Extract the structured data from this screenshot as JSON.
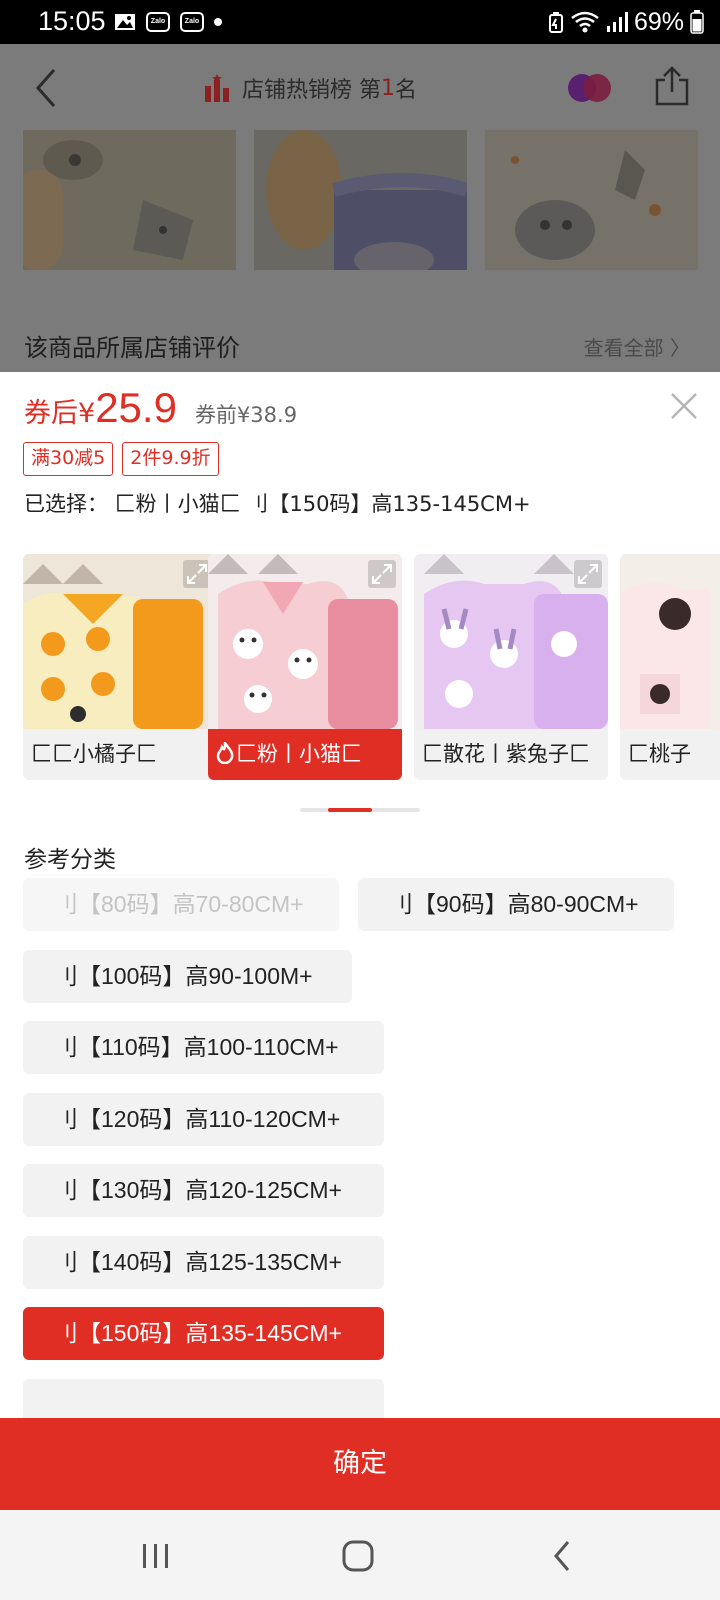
{
  "status_bar": {
    "time": "15:05",
    "notification_icons": [
      "image-icon",
      "zalo-icon",
      "zalo-icon",
      "dot-icon"
    ],
    "zalo_text": "Zalo",
    "battery": "69%"
  },
  "background_page": {
    "rank_prefix": "店铺热销榜 第",
    "rank_number": "1",
    "rank_suffix": "名",
    "review_title": "该商品所属店铺评价",
    "view_all": "查看全部"
  },
  "sheet": {
    "price_prefix": "券后¥",
    "price_value": "25.9",
    "original_price": "券前¥38.9",
    "promos": [
      "满30减5",
      "2件9.9折"
    ],
    "selected": "已选择： 匚粉丨小猫匚  刂【150码】高135-145CM+",
    "variants": [
      {
        "label": "匚匚小橘子匚",
        "selected": false
      },
      {
        "label": "匚粉丨小猫匚",
        "selected": true
      },
      {
        "label": "匚散花丨紫兔子匚",
        "selected": false
      },
      {
        "label": "匚桃子",
        "selected": false
      }
    ],
    "scroll_position": 0.37,
    "section_title": "参考分类",
    "sizes": [
      {
        "label": "刂【80码】高70-80CM+",
        "state": "disabled"
      },
      {
        "label": "刂【90码】高80-90CM+",
        "state": "normal"
      },
      {
        "label": "刂【100码】高90-100M+",
        "state": "normal"
      },
      {
        "label": "刂【110码】高100-110CM+",
        "state": "normal"
      },
      {
        "label": "刂【120码】高110-120CM+",
        "state": "normal"
      },
      {
        "label": "刂【130码】高120-125CM+",
        "state": "normal"
      },
      {
        "label": "刂【140码】高125-135CM+",
        "state": "normal"
      },
      {
        "label": "刂【150码】高135-145CM+",
        "state": "selected"
      }
    ],
    "confirm": "确定"
  },
  "colors": {
    "accent": "#e02e24",
    "overlay": "#7b7b7b"
  }
}
